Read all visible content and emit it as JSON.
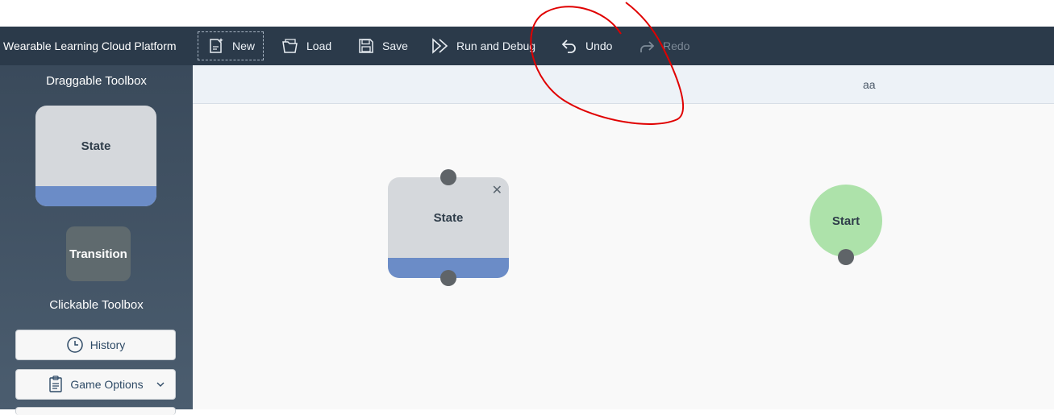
{
  "app": {
    "title": "Wearable Learning Cloud Platform"
  },
  "toolbar": {
    "new_label": "New",
    "load_label": "Load",
    "save_label": "Save",
    "run_label": "Run and Debug",
    "undo_label": "Undo",
    "redo_label": "Redo"
  },
  "sidebar": {
    "draggable_title": "Draggable Toolbox",
    "state_label": "State",
    "transition_label": "Transition",
    "clickable_title": "Clickable Toolbox",
    "history_label": "History",
    "game_options_label": "Game Options"
  },
  "canvas": {
    "game_name": "aa",
    "state_node_label": "State",
    "start_node_label": "Start"
  },
  "colors": {
    "toolbar_bg": "#2b3a4a",
    "state_stripe": "#6b8cc7",
    "start_node": "#ade2aa",
    "annotation_stroke": "#e00000"
  },
  "icons": [
    "new-icon",
    "load-icon",
    "save-icon",
    "run-icon",
    "undo-icon",
    "redo-icon",
    "history-icon",
    "clipboard-icon",
    "chevron-down-icon",
    "close-icon"
  ]
}
